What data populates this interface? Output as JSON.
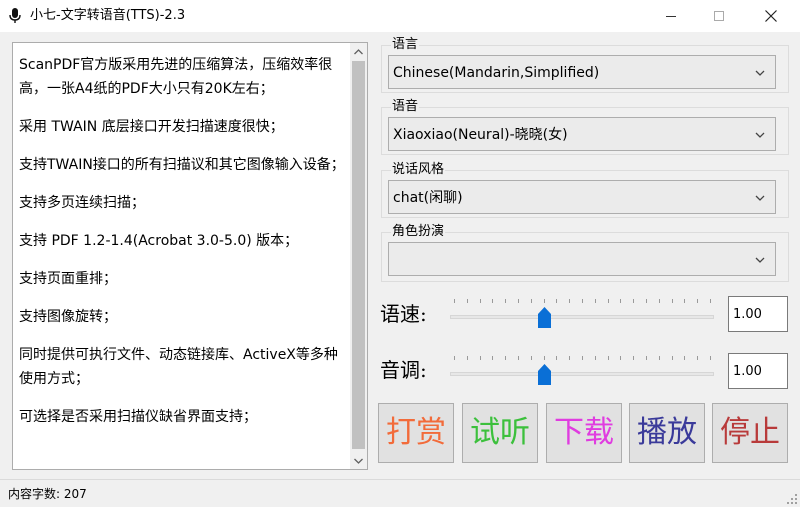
{
  "window": {
    "title": "小七-文字转语音(TTS)-2.3",
    "icon": "microphone-icon"
  },
  "text_area": {
    "paragraphs": [
      "ScanPDF官方版采用先进的压缩算法，压缩效率很高，一张A4纸的PDF大小只有20K左右；",
      "采用 TWAIN 底层接口开发扫描速度很快；",
      "支持TWAIN接口的所有扫描议和其它图像输入设备；",
      "支持多页连续扫描；",
      "支持 PDF 1.2-1.4(Acrobat 3.0-5.0) 版本；",
      "支持页面重排；",
      "支持图像旋转；",
      "同时提供可执行文件、动态链接库、ActiveX等多种使用方式；",
      "可选择是否采用扫描仪缺省界面支持；"
    ]
  },
  "language": {
    "label": "语言",
    "value": "Chinese(Mandarin,Simplified)"
  },
  "voice": {
    "label": "语音",
    "value": "Xiaoxiao(Neural)-晓晓(女)"
  },
  "style": {
    "label": "说话风格",
    "value": "chat(闲聊)"
  },
  "role": {
    "label": "角色扮演",
    "value": ""
  },
  "rate": {
    "label": "语速:",
    "value": "1.00",
    "level": 0.5
  },
  "pitch": {
    "label": "音调:",
    "value": "1.00",
    "level": 0.5
  },
  "buttons": {
    "reward": "打赏",
    "preview": "试听",
    "download": "下载",
    "play": "播放",
    "stop": "停止"
  },
  "colors": {
    "reward": "#f26b3a",
    "preview": "#3cc03c",
    "download": "#e03ce0",
    "play": "#3a3a9a",
    "stop": "#b83a3a",
    "slider_thumb": "#0a6fd6"
  },
  "status": {
    "char_count": "内容字数: 207"
  }
}
